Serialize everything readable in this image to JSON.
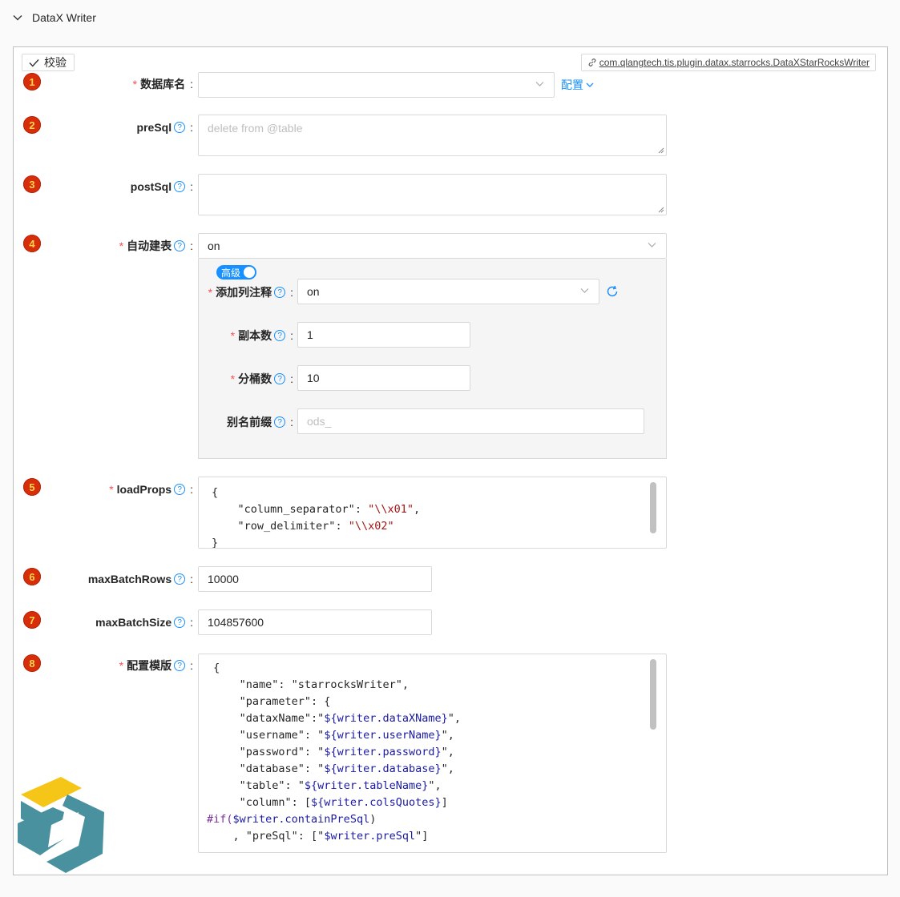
{
  "header": {
    "title": "DataX Writer"
  },
  "toolbar": {
    "verify_label": "校验",
    "impl_class": "com.qlangtech.tis.plugin.datax.starrocks.DataXStarRocksWriter"
  },
  "badges": [
    "1",
    "2",
    "3",
    "4",
    "5",
    "6",
    "7",
    "8"
  ],
  "fields": {
    "dbName": {
      "label": "数据库名",
      "value": "",
      "config_link": "配置"
    },
    "preSql": {
      "label": "preSql",
      "placeholder": "delete from @table"
    },
    "postSql": {
      "label": "postSql",
      "value": ""
    },
    "autoCreateTable": {
      "label": "自动建表",
      "value": "on"
    },
    "advanced_toggle": "高级",
    "addComment": {
      "label": "添加列注释",
      "value": "on"
    },
    "replicationNum": {
      "label": "副本数",
      "value": "1"
    },
    "bucketsNum": {
      "label": "分桶数",
      "value": "10"
    },
    "aliasPrefix": {
      "label": "别名前缀",
      "placeholder": "ods_"
    },
    "loadProps": {
      "label": "loadProps"
    },
    "maxBatchRows": {
      "label": "maxBatchRows",
      "value": "10000"
    },
    "maxBatchSize": {
      "label": "maxBatchSize",
      "value": "104857600"
    },
    "template": {
      "label": "配置模版"
    }
  },
  "loadProps_code": [
    "{",
    "    \"column_separator\": \"\\\\x01\",",
    "    \"row_delimiter\": \"\\\\x02\"",
    "}"
  ],
  "template_code": [
    "{",
    "  \"name\": \"starrocksWriter\",",
    "  \"parameter\": {",
    "    \"dataxName\":\"${writer.dataXName}\",",
    "    \"username\": \"${writer.userName}\",",
    "    \"password\": \"${writer.password}\",",
    "    \"database\": \"${writer.database}\",",
    "    \"table\": \"${writer.tableName}\",",
    "    \"column\": [${writer.colsQuotes}]",
    "#if($writer.containPreSql)",
    "   , \"preSql\": [\"$writer.preSql\"]"
  ],
  "colors": {
    "accent": "#1890ff",
    "required": "#ff4d4f",
    "badge": "#d72d0a"
  }
}
